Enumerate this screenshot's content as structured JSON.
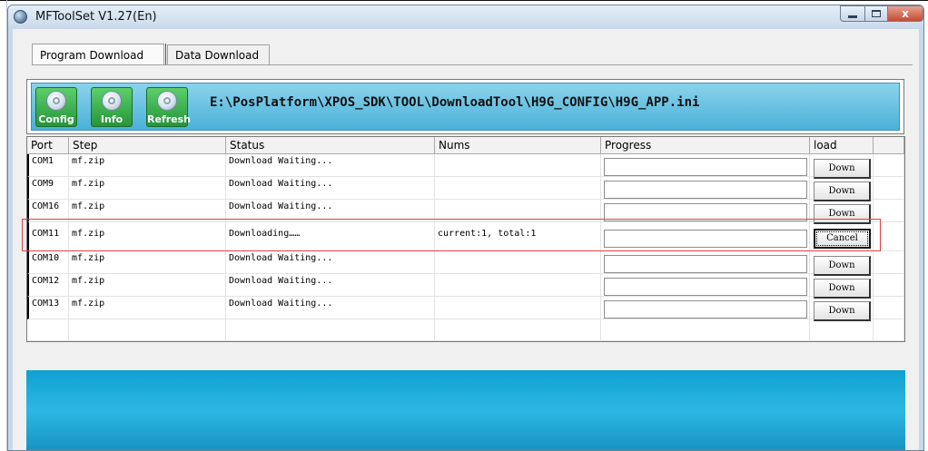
{
  "window": {
    "title": "MFToolSet V1.27(En)",
    "close_glyph": "x"
  },
  "tabs": [
    {
      "label": "Program Download",
      "active": true
    },
    {
      "label": "Data Download",
      "active": false
    }
  ],
  "toolbar": {
    "buttons": [
      {
        "label": "Config",
        "icon": "config-icon"
      },
      {
        "label": "Info",
        "icon": "info-icon"
      },
      {
        "label": "Refresh",
        "icon": "refresh-icon"
      }
    ],
    "config_path": "E:\\PosPlatform\\XPOS_SDK\\TOOL\\DownloadTool\\H9G_CONFIG\\H9G_APP.ini"
  },
  "grid": {
    "columns": [
      "Port",
      "Step",
      "Status",
      "Nums",
      "Progress",
      "load",
      ""
    ],
    "rows": [
      {
        "port": "COM1",
        "step": "mf.zip",
        "status": "Download Waiting...",
        "nums": "",
        "action": "Down"
      },
      {
        "port": "COM9",
        "step": "mf.zip",
        "status": "Download Waiting...",
        "nums": "",
        "action": "Down"
      },
      {
        "port": "COM16",
        "step": "mf.zip",
        "status": "Download Waiting...",
        "nums": "",
        "action": "Down"
      },
      {
        "port": "COM11",
        "step": "mf.zip",
        "status": "Downloading……",
        "nums": "current:1, total:1",
        "action": "Cancel"
      },
      {
        "port": "COM10",
        "step": "mf.zip",
        "status": "Download Waiting...",
        "nums": "",
        "action": "Down"
      },
      {
        "port": "COM12",
        "step": "mf.zip",
        "status": "Download Waiting...",
        "nums": "",
        "action": "Down"
      },
      {
        "port": "COM13",
        "step": "mf.zip",
        "status": "Download Waiting...",
        "nums": "",
        "action": "Down"
      }
    ]
  },
  "colors": {
    "toolbar_gradient": "#4ab1d8",
    "button_green": "#26963a",
    "bottom_band": "#10a0d0",
    "highlight_red": "#e04040"
  }
}
